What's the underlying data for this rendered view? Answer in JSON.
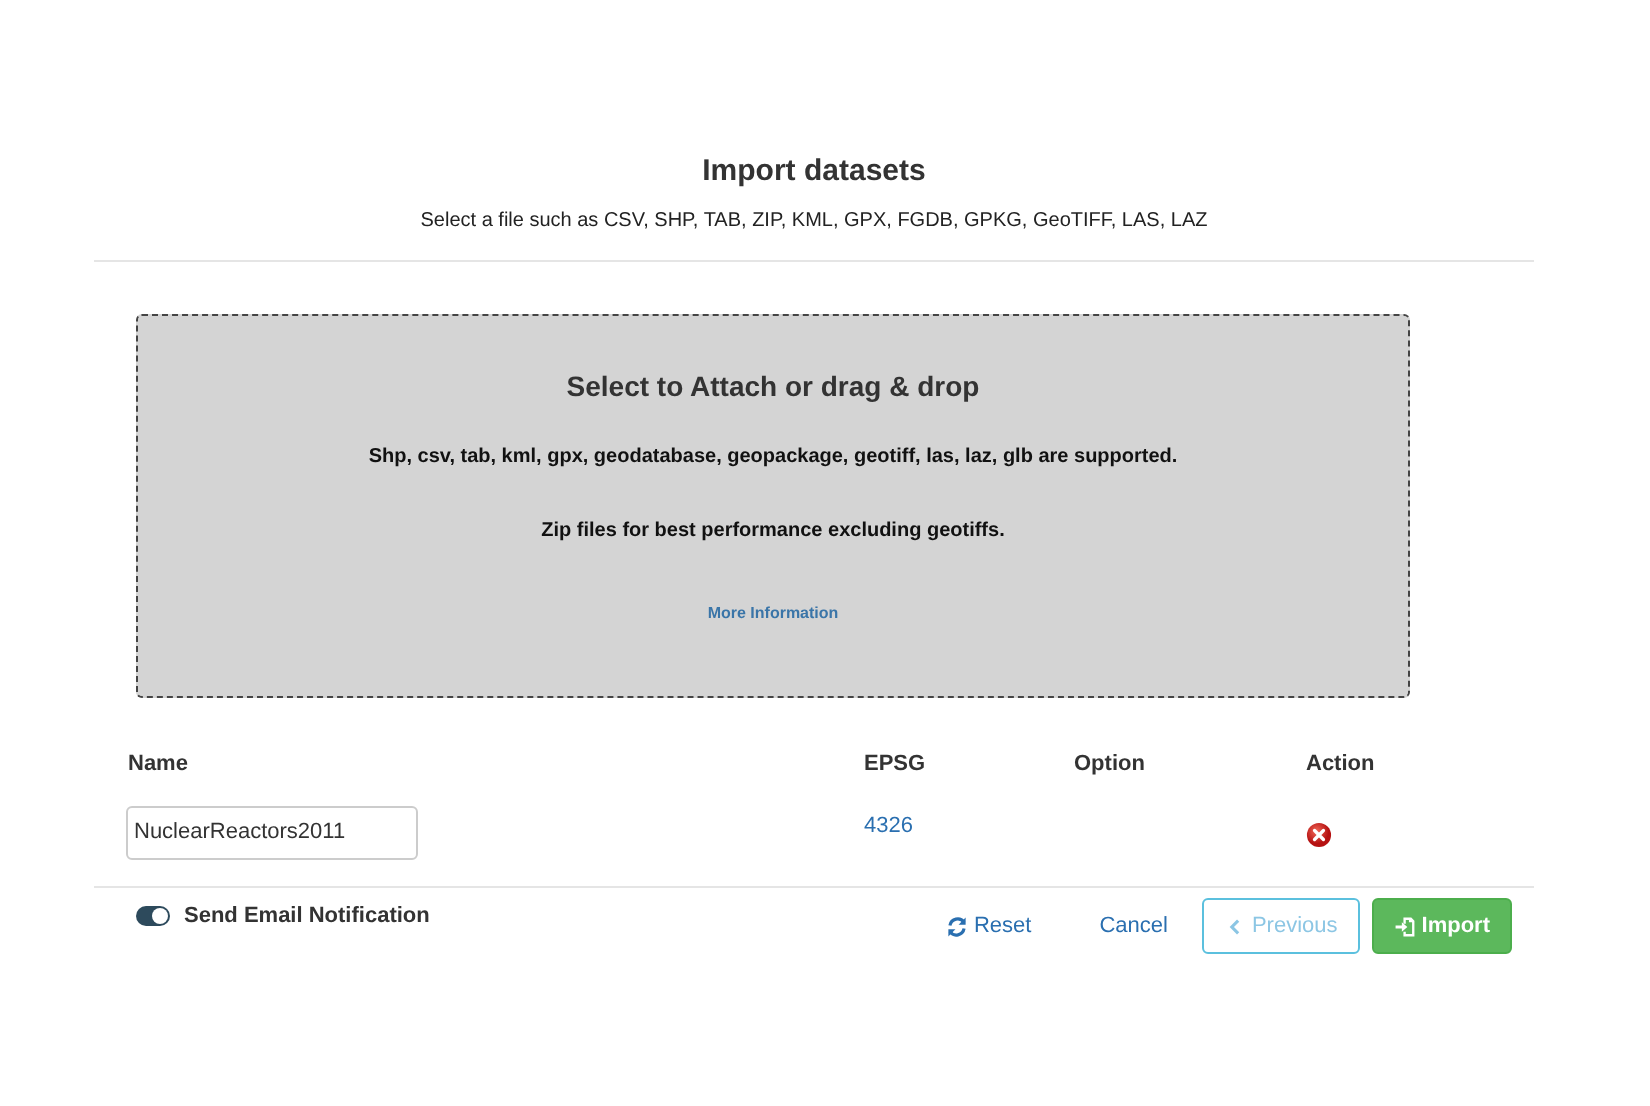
{
  "header": {
    "title": "Import datasets",
    "subtitle": "Select a file such as CSV, SHP, TAB, ZIP, KML, GPX, FGDB, GPKG, GeoTIFF, LAS, LAZ"
  },
  "dropzone": {
    "title": "Select to Attach or drag & drop",
    "lines": [
      "Shp, csv, tab, kml, gpx, geodatabase, geopackage, geotiff, las, laz, glb are supported.",
      "Zip files for best performance excluding geotiffs."
    ],
    "link": "More Information"
  },
  "table": {
    "columns": [
      "Name",
      "EPSG",
      "Option",
      "Action"
    ],
    "rows": [
      {
        "name": "NuclearReactors2011",
        "epsg": "4326"
      }
    ]
  },
  "footer": {
    "notification": {
      "label": "Send Email Notification",
      "on": true
    },
    "buttons": [
      {
        "kind": "reset",
        "label": "Reset",
        "disabled": false
      },
      {
        "kind": "cancel",
        "label": "Cancel",
        "disabled": false
      },
      {
        "kind": "previous",
        "label": "Previous",
        "disabled": true
      },
      {
        "kind": "import",
        "label": "Import",
        "disabled": false
      }
    ]
  }
}
